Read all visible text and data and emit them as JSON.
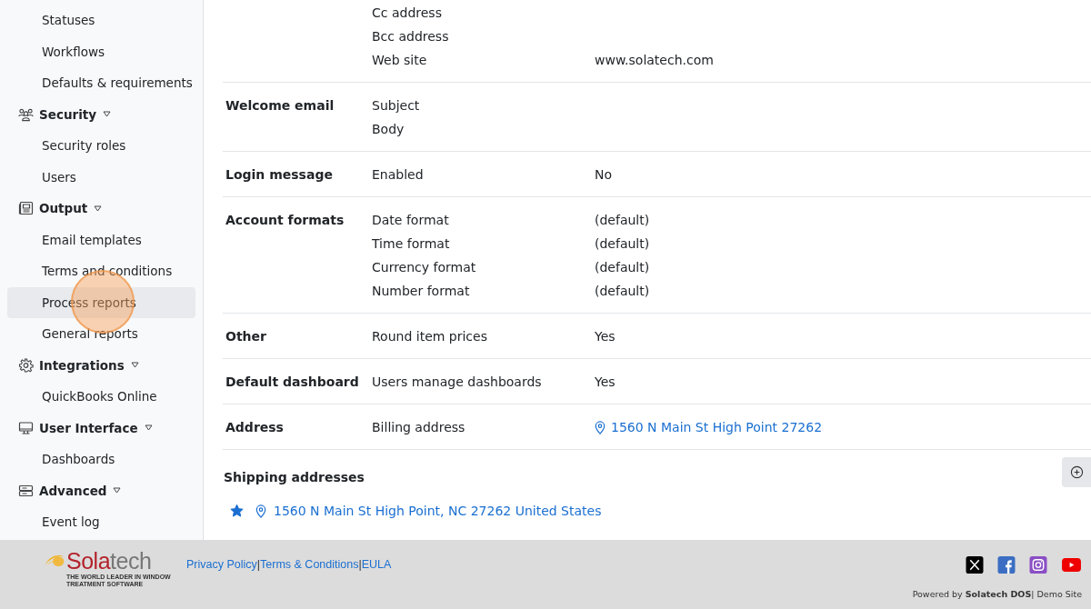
{
  "sidebar": {
    "items": [
      {
        "kind": "link",
        "label": "Statuses",
        "selected": false
      },
      {
        "kind": "link",
        "label": "Workflows",
        "selected": false
      },
      {
        "kind": "link",
        "label": "Defaults & requirements",
        "selected": false
      },
      {
        "kind": "group",
        "label": "Security",
        "expanded": true
      },
      {
        "kind": "link",
        "label": "Security roles",
        "selected": false
      },
      {
        "kind": "link",
        "label": "Users",
        "selected": false
      },
      {
        "kind": "group",
        "label": "Output",
        "expanded": true
      },
      {
        "kind": "link",
        "label": "Email templates",
        "selected": false
      },
      {
        "kind": "link",
        "label": "Terms and conditions",
        "selected": false
      },
      {
        "kind": "link",
        "label": "Process reports",
        "selected": true
      },
      {
        "kind": "link",
        "label": "General reports",
        "selected": false
      },
      {
        "kind": "group",
        "label": "Integrations",
        "expanded": true
      },
      {
        "kind": "link",
        "label": "QuickBooks Online",
        "selected": false
      },
      {
        "kind": "group",
        "label": "User Interface",
        "expanded": true
      },
      {
        "kind": "link",
        "label": "Dashboards",
        "selected": false
      },
      {
        "kind": "group",
        "label": "Advanced",
        "expanded": true
      },
      {
        "kind": "link",
        "label": "Event log",
        "selected": false
      }
    ]
  },
  "settings": [
    {
      "fields": [
        {
          "label": "Cc address"
        },
        {
          "label": "Bcc address"
        },
        {
          "label": "Web site",
          "value": "www.solatech.com",
          "kind": "text"
        }
      ]
    },
    {
      "section": "Welcome email",
      "fields": [
        {
          "label": "Subject"
        },
        {
          "label": "Body"
        }
      ]
    },
    {
      "section": "Login message",
      "fields": [
        {
          "label": "Enabled",
          "value": "No",
          "kind": "text"
        }
      ]
    },
    {
      "section": "Account formats",
      "fields": [
        {
          "label": "Date format",
          "value": "(default)",
          "kind": "text"
        },
        {
          "label": "Time format",
          "value": "(default)",
          "kind": "text"
        },
        {
          "label": "Currency format",
          "value": "(default)",
          "kind": "text"
        },
        {
          "label": "Number format",
          "value": "(default)",
          "kind": "text"
        }
      ]
    },
    {
      "section": "Other",
      "fields": [
        {
          "label": "Round item prices",
          "value": "Yes",
          "kind": "text"
        }
      ]
    },
    {
      "section": "Default dashboard",
      "fields": [
        {
          "label": "Users manage dashboards",
          "value": "Yes",
          "kind": "text"
        }
      ]
    },
    {
      "section": "Address",
      "fields": [
        {
          "label": "Billing address",
          "value": "1560 N Main St High Point 27262",
          "kind": "address"
        }
      ]
    }
  ],
  "shipping": {
    "title": "Shipping addresses",
    "addresses": [
      {
        "text": "1560 N Main St High Point, NC 27262 United States",
        "default": true
      }
    ]
  },
  "footer": {
    "logo": {
      "name": "Solatech",
      "tagline": "THE WORLD LEADER IN WINDOW TREATMENT SOFTWARE"
    },
    "links": [
      "Privacy Policy",
      "Terms & Conditions",
      "EULA"
    ],
    "separators": [
      "|",
      "|"
    ],
    "powered": "Powered by **Solatech DOS**| Demo Site"
  }
}
